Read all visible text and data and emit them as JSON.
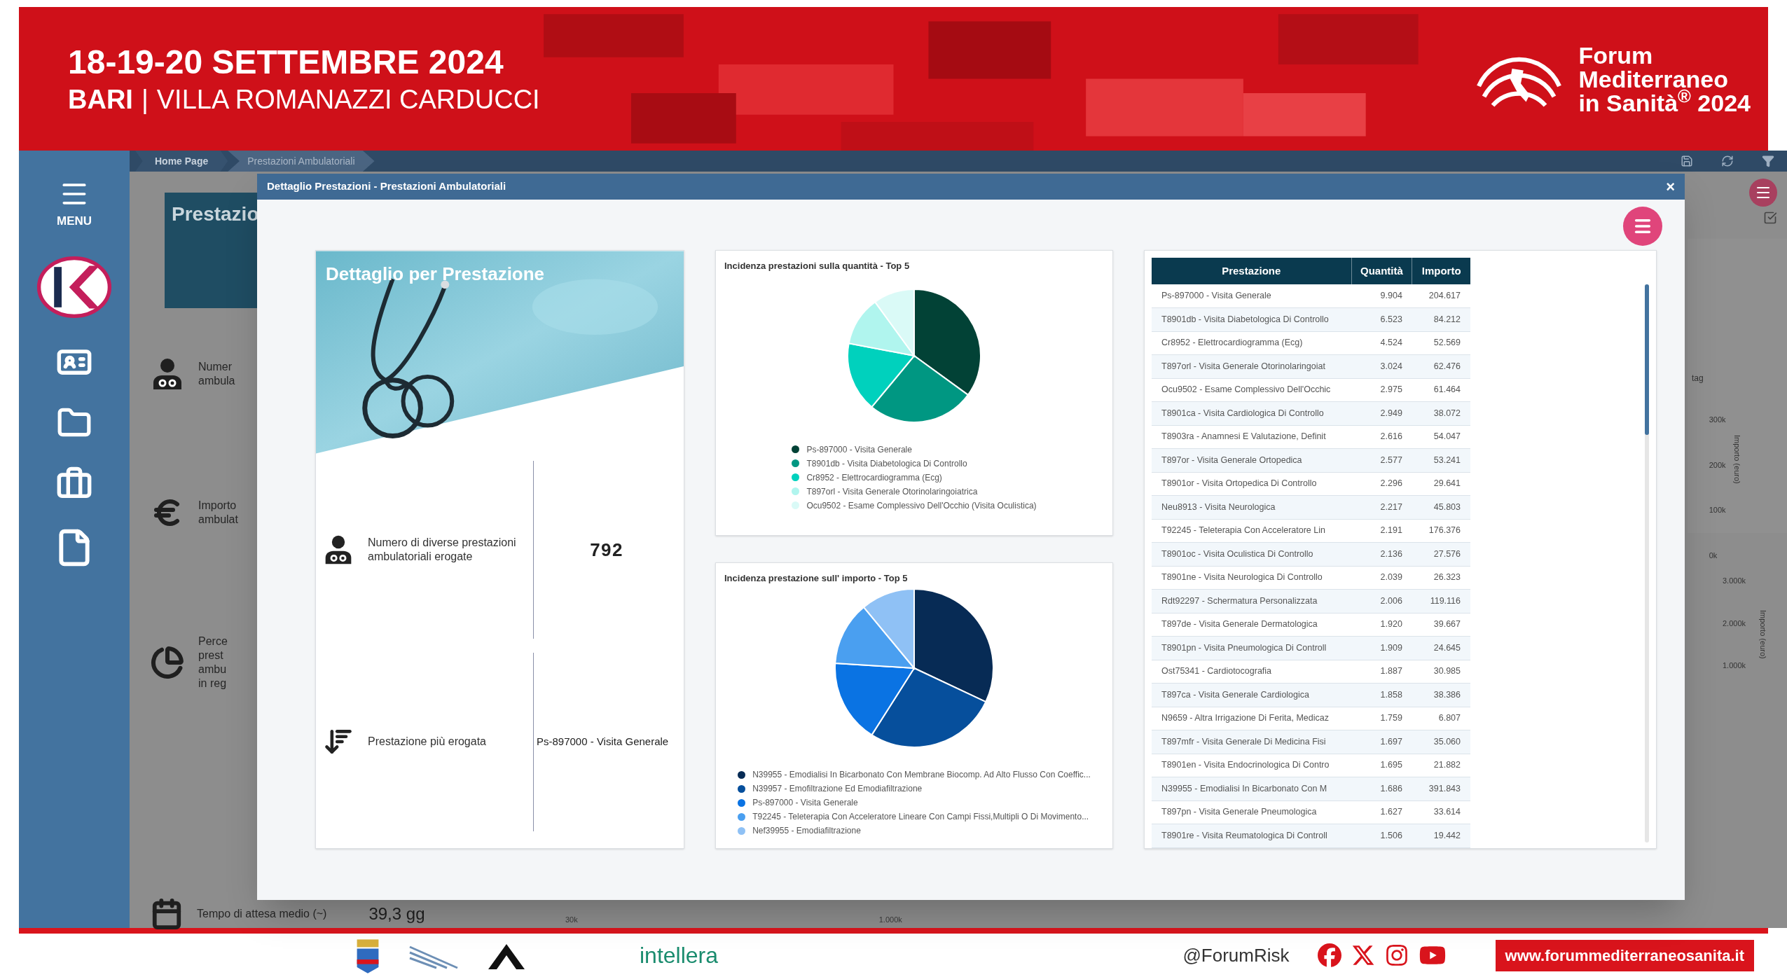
{
  "banner": {
    "dates": "18-19-20 SETTEMBRE 2024",
    "city": "BARI",
    "separator": "|",
    "venue": "VILLA ROMANAZZI CARDUCCI",
    "logo_lines": [
      "Forum",
      "Mediterraneo",
      "in Sanità$^{®}$ 2024"
    ]
  },
  "sidebar": {
    "menu_label": "MENU"
  },
  "breadcrumbs": [
    {
      "label": "Home Page",
      "selected": false
    },
    {
      "label": "Prestazioni Ambulatoriali",
      "selected": true
    }
  ],
  "background": {
    "panel_title": "Prestazio",
    "kpis": [
      {
        "kind": "doctor",
        "lines": [
          "Numer",
          "ambula"
        ]
      },
      {
        "kind": "euro",
        "lines": [
          "Importo",
          "ambulat"
        ]
      },
      {
        "kind": "pie",
        "lines": [
          "Perce",
          "prest",
          "ambu",
          "in reg"
        ]
      }
    ],
    "wait": {
      "label": "Tempo di attesa medio (~)",
      "value": "39,3 gg"
    },
    "bottom_ticks": [
      "30k",
      "1.000k"
    ],
    "right_top": {
      "cut_label": "tag",
      "ticks": [
        "300k",
        "200k",
        "100k",
        "0k"
      ],
      "title": "Importo (euro)"
    },
    "right_bottom": {
      "ticks": [
        "3.000k",
        "2.000k",
        "1.000k"
      ],
      "title": "Importo (euro)"
    }
  },
  "modal": {
    "title": "Dettaglio Prestazioni - Prestazioni Ambulatoriali",
    "close": "×",
    "detail_card": {
      "title": "Dettaglio per Prestazione",
      "rows": [
        {
          "kind": "doctor",
          "label": "Numero di diverse prestazioni ambulatoriali erogate",
          "value": "792"
        },
        {
          "kind": "sort",
          "label": "Prestazione più erogata",
          "value": "Ps-897000 - Visita Generale"
        }
      ]
    },
    "pie_charts": [
      {
        "title": "Incidenza prestazioni sulla quantità - Top 5",
        "legend": [
          {
            "label": "Ps-897000 - Visita Generale",
            "color": "#024236"
          },
          {
            "label": "T8901db - Visita Diabetologica Di Controllo",
            "color": "#009782"
          },
          {
            "label": "Cr8952 - Elettrocardiogramma (Ecg)",
            "color": "#00d1bd"
          },
          {
            "label": "T897orl - Visita Generale Otorinolaringoiatrica",
            "color": "#b0f5ee"
          },
          {
            "label": "Ocu9502 - Esame Complessivo Dell'Occhio (Visita Oculistica)",
            "color": "#dafaf7"
          }
        ]
      },
      {
        "title": "Incidenza prestazione sull' importo - Top 5",
        "legend": [
          {
            "label": "N39955 - Emodialisi In Bicarbonato Con Membrane Biocomp. Ad Alto Flusso Con Coeffic...",
            "color": "#072b55"
          },
          {
            "label": "N39957 - Emofiltrazione Ed Emodiafiltrazione",
            "color": "#064f9c"
          },
          {
            "label": "Ps-897000 - Visita Generale",
            "color": "#0a73e3"
          },
          {
            "label": "T92245 - Teleterapia Con Acceleratore Lineare Con Campi Fissi,Multipli O Di Movimento...",
            "color": "#4a9ff0"
          },
          {
            "label": "Nef39955 - Emodiafiltrazione",
            "color": "#8fc1f5"
          }
        ]
      }
    ],
    "table": {
      "columns": [
        "Prestazione",
        "Quantità",
        "Importo"
      ],
      "rows": [
        [
          "Ps-897000 - Visita Generale",
          "9.904",
          "204.617"
        ],
        [
          "T8901db - Visita Diabetologica Di Controllo",
          "6.523",
          "84.212"
        ],
        [
          "Cr8952 - Elettrocardiogramma (Ecg)",
          "4.524",
          "52.569"
        ],
        [
          "T897orl - Visita Generale Otorinolaringoiat",
          "3.024",
          "62.476"
        ],
        [
          "Ocu9502 - Esame Complessivo Dell'Occhic",
          "2.975",
          "61.464"
        ],
        [
          "T8901ca - Visita Cardiologica Di Controllo",
          "2.949",
          "38.072"
        ],
        [
          "T8903ra - Anamnesi E Valutazione, Definit",
          "2.616",
          "54.047"
        ],
        [
          "T897or - Visita Generale Ortopedica",
          "2.577",
          "53.241"
        ],
        [
          "T8901or - Visita Ortopedica Di Controllo",
          "2.296",
          "29.641"
        ],
        [
          "Neu8913 - Visita Neurologica",
          "2.217",
          "45.803"
        ],
        [
          "T92245 - Teleterapia Con Acceleratore Lin",
          "2.191",
          "176.376"
        ],
        [
          "T8901oc - Visita Oculistica Di Controllo",
          "2.136",
          "27.576"
        ],
        [
          "T8901ne - Visita Neurologica Di Controllo",
          "2.039",
          "26.323"
        ],
        [
          "Rdt92297 - Schermatura Personalizzata",
          "2.006",
          "119.116"
        ],
        [
          "T897de - Visita Generale Dermatologica",
          "1.920",
          "39.667"
        ],
        [
          "T8901pn - Visita Pneumologica Di Controll",
          "1.909",
          "24.645"
        ],
        [
          "Ost75341 - Cardiotocografia",
          "1.887",
          "30.985"
        ],
        [
          "T897ca - Visita Generale Cardiologica",
          "1.858",
          "38.386"
        ],
        [
          "N9659 - Altra Irrigazione Di Ferita, Medicaz",
          "1.759",
          "6.807"
        ],
        [
          "T897mfr - Visita Generale Di Medicina Fisi",
          "1.697",
          "35.060"
        ],
        [
          "T8901en - Visita Endocrinologica Di Contro",
          "1.695",
          "21.882"
        ],
        [
          "N39955 - Emodialisi In Bicarbonato Con M",
          "1.686",
          "391.843"
        ],
        [
          "T897pn - Visita Generale Pneumologica",
          "1.627",
          "33.614"
        ],
        [
          "T8901re - Visita Reumatologica Di Controll",
          "1.506",
          "19.442"
        ]
      ]
    }
  },
  "footer": {
    "sponsor": "intellera",
    "handle": "@ForumRisk",
    "url": "www.forummediterraneosanita.it"
  }
}
